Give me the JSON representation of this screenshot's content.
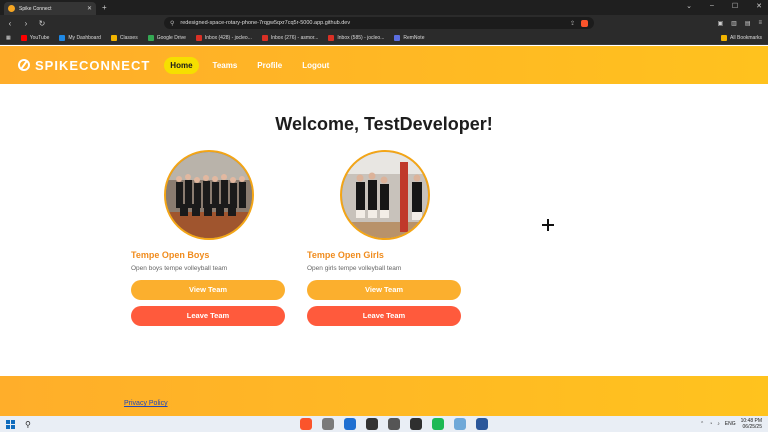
{
  "browser": {
    "tab_title": "Spike Connect",
    "url": "redesigned-space-rotary-phone-7rqgw5qxr7cq5r-5000.app.github.dev",
    "bookmarks": [
      {
        "label": "YouTube",
        "color": "#ff0000"
      },
      {
        "label": "My Dashboard",
        "color": "#1e88e5"
      },
      {
        "label": "Classes",
        "color": "#f2b400"
      },
      {
        "label": "Google Drive",
        "color": "#34a853"
      },
      {
        "label": "Inbox (428) - jocleo...",
        "color": "#d93025"
      },
      {
        "label": "Inbox (276) - asmor...",
        "color": "#d93025"
      },
      {
        "label": "Inbox (585) - jocleo...",
        "color": "#d93025"
      },
      {
        "label": "RemNote",
        "color": "#5b6ee1"
      }
    ],
    "all_bookmarks": "All Bookmarks"
  },
  "site": {
    "brand": "SPIKECONNECT",
    "nav": [
      "Home",
      "Teams",
      "Profile",
      "Logout"
    ],
    "active_nav": "Home",
    "welcome": "Welcome, TestDeveloper!",
    "teams": [
      {
        "name": "Tempe Open Boys",
        "description": "Open boys tempe volleyball team",
        "view_label": "View Team",
        "leave_label": "Leave Team"
      },
      {
        "name": "Tempe Open Girls",
        "description": "Open girls tempe volleyball team",
        "view_label": "View Team",
        "leave_label": "Leave Team"
      }
    ],
    "footer_link": "Privacy Policy"
  },
  "colors": {
    "accent": "#ffb22a",
    "team_name": "#f08c1e",
    "view_button": "#fbaf2e",
    "leave_button": "#ff5a3c",
    "active_nav": "#f6df00"
  },
  "taskbar": {
    "time": "10:48 PM",
    "date": "06/25/25",
    "lang": "ENG"
  }
}
